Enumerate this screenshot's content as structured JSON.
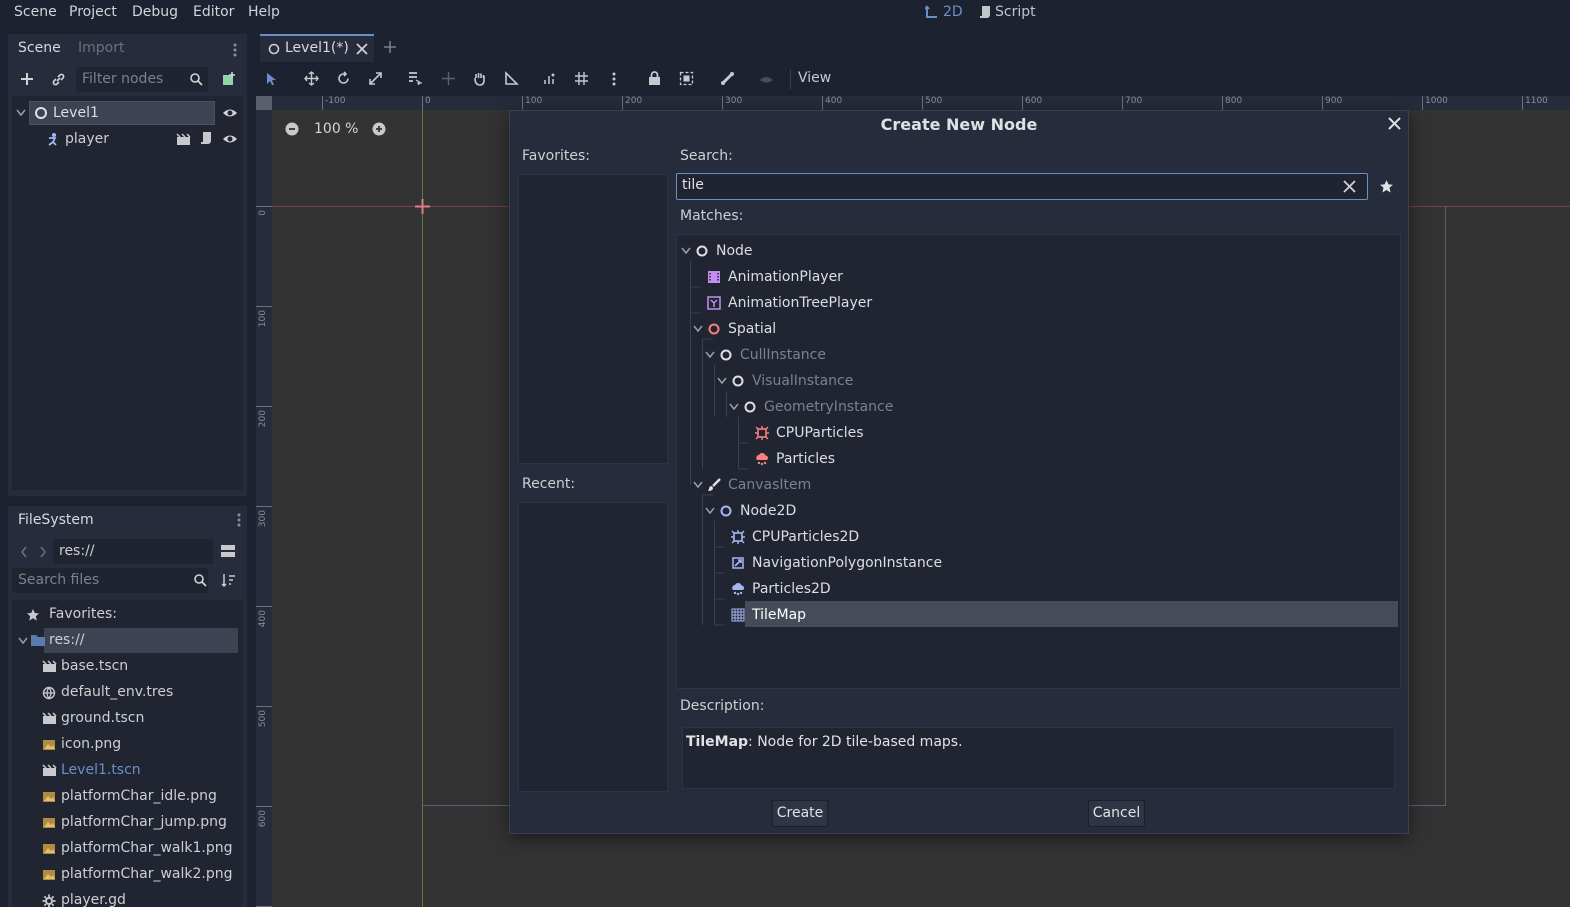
{
  "menubar": {
    "items": [
      "Scene",
      "Project",
      "Debug",
      "Editor",
      "Help"
    ],
    "workspace_2d": "2D",
    "workspace_script": "Script"
  },
  "scene_dock": {
    "tabs": [
      "Scene",
      "Import"
    ],
    "filter_placeholder": "Filter nodes",
    "tree": [
      {
        "label": "Level1",
        "icon": "node-circle-icon"
      },
      {
        "label": "player",
        "icon": "kinematic-body-icon"
      }
    ]
  },
  "filesystem": {
    "tab": "FileSystem",
    "path": "res://",
    "search_placeholder": "Search files",
    "favorites_label": "Favorites:",
    "root_label": "res://",
    "files": [
      {
        "name": "base.tscn",
        "icon": "scene-clapper-icon"
      },
      {
        "name": "default_env.tres",
        "icon": "environment-globe-icon"
      },
      {
        "name": "ground.tscn",
        "icon": "scene-clapper-icon"
      },
      {
        "name": "icon.png",
        "icon": "image-icon"
      },
      {
        "name": "Level1.tscn",
        "icon": "scene-clapper-icon"
      },
      {
        "name": "platformChar_idle.png",
        "icon": "image-icon"
      },
      {
        "name": "platformChar_jump.png",
        "icon": "image-icon"
      },
      {
        "name": "platformChar_walk1.png",
        "icon": "image-icon"
      },
      {
        "name": "platformChar_walk2.png",
        "icon": "image-icon"
      },
      {
        "name": "player.gd",
        "icon": "gear-script-icon"
      }
    ]
  },
  "editor": {
    "tab_label": "Level1(*)",
    "view_menu": "View",
    "zoom": "100 %",
    "ruler_h": [
      "-100",
      "0",
      "100",
      "200",
      "300",
      "400",
      "500",
      "600",
      "700",
      "800",
      "900",
      "1000",
      "1100"
    ],
    "ruler_v": [
      "0",
      "100",
      "200",
      "300",
      "400",
      "500",
      "600",
      "700"
    ]
  },
  "dialog": {
    "title": "Create New Node",
    "favorites_label": "Favorites:",
    "recent_label": "Recent:",
    "search_label": "Search:",
    "search_value": "tile",
    "matches_label": "Matches:",
    "matches": [
      {
        "label": "Node",
        "dim": false
      },
      {
        "label": "AnimationPlayer",
        "dim": false
      },
      {
        "label": "AnimationTreePlayer",
        "dim": false
      },
      {
        "label": "Spatial",
        "dim": false
      },
      {
        "label": "CullInstance",
        "dim": true
      },
      {
        "label": "VisualInstance",
        "dim": true
      },
      {
        "label": "GeometryInstance",
        "dim": true
      },
      {
        "label": "CPUParticles",
        "dim": false
      },
      {
        "label": "Particles",
        "dim": false
      },
      {
        "label": "CanvasItem",
        "dim": true
      },
      {
        "label": "Node2D",
        "dim": false
      },
      {
        "label": "CPUParticles2D",
        "dim": false
      },
      {
        "label": "NavigationPolygonInstance",
        "dim": false
      },
      {
        "label": "Particles2D",
        "dim": false
      },
      {
        "label": "TileMap",
        "dim": false,
        "selected": true
      }
    ],
    "description_label": "Description:",
    "description_name": "TileMap",
    "description_text": ": Node for 2D tile-based maps.",
    "create_button": "Create",
    "cancel_button": "Cancel"
  },
  "colors": {
    "accent": "#6a8fc8",
    "spatial_red": "#fc7f7f",
    "node2d_blue": "#a5b7f3",
    "animation_purple": "#c38ef1",
    "selected_row": "#454b58"
  }
}
